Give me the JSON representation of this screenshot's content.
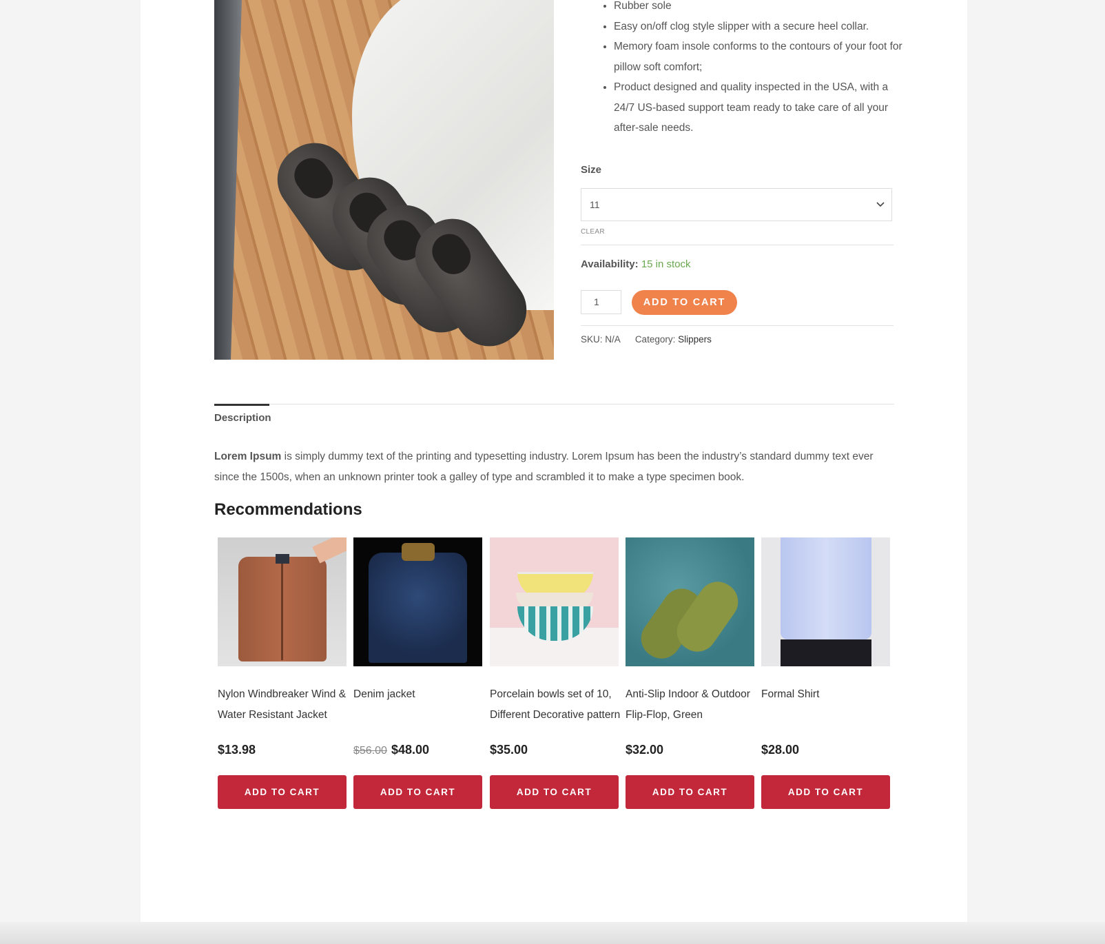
{
  "product": {
    "bullets": [
      "Rubber sole",
      "Easy on/off clog style slipper with a secure heel collar.",
      "Memory foam insole conforms to the contours of your foot for pillow soft comfort;",
      "Product designed and quality inspected in the USA, with a 24/7 US-based support team ready to take care of all your after-sale needs."
    ],
    "size_label": "Size",
    "size_value": "11",
    "clear_label": "CLEAR",
    "availability_label": "Availability:",
    "availability_value": "15 in stock",
    "quantity": "1",
    "add_to_cart": "ADD TO CART",
    "sku_label": "SKU:",
    "sku_value": "N/A",
    "category_label": "Category:",
    "category_value": "Slippers"
  },
  "tabs": {
    "description": "Description"
  },
  "description": {
    "bold": "Lorem Ipsum",
    "text": " is simply dummy text of the printing and typesetting industry. Lorem Ipsum has been the industry’s standard dummy text ever since the 1500s, when an unknown printer took a galley of type and scrambled it to make a type specimen book."
  },
  "recommendations": {
    "title": "Recommendations",
    "items": [
      {
        "title": "Nylon Windbreaker Wind & Water Resistant Jacket",
        "old_price": "",
        "price": "$13.98",
        "button": "ADD TO CART"
      },
      {
        "title": "Denim jacket",
        "old_price": "$56.00",
        "price": "$48.00",
        "button": "ADD TO CART"
      },
      {
        "title": "Porcelain bowls set of 10, Different Decorative pattern",
        "old_price": "",
        "price": "$35.00",
        "button": "ADD TO CART"
      },
      {
        "title": "Anti-Slip Indoor & Outdoor Flip-Flop, Green",
        "old_price": "",
        "price": "$32.00",
        "button": "ADD TO CART"
      },
      {
        "title": "Formal Shirt",
        "old_price": "",
        "price": "$28.00",
        "button": "ADD TO CART"
      }
    ]
  },
  "colors": {
    "accent_orange": "#f0824c",
    "cart_red": "#c3283a",
    "stock_green": "#6aa84f"
  }
}
